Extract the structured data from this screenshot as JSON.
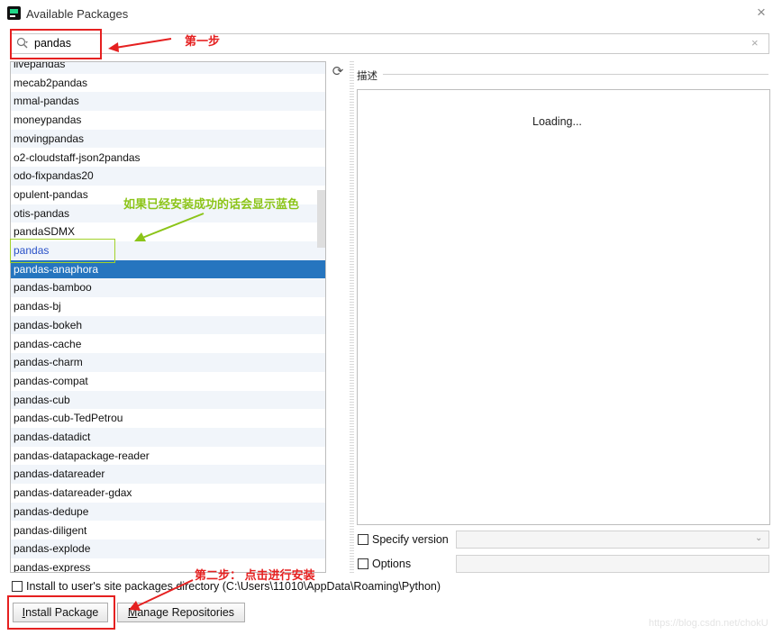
{
  "window": {
    "title": "Available Packages",
    "close_icon": "close-icon"
  },
  "search": {
    "value": "pandas",
    "clear_glyph": "×"
  },
  "packages": [
    "livepandas",
    "mecab2pandas",
    "mmal-pandas",
    "moneypandas",
    "movingpandas",
    "o2-cloudstaff-json2pandas",
    "odo-fixpandas20",
    "opulent-pandas",
    "otis-pandas",
    "pandaSDMX",
    "pandas",
    "pandas-anaphora",
    "pandas-bamboo",
    "pandas-bj",
    "pandas-bokeh",
    "pandas-cache",
    "pandas-charm",
    "pandas-compat",
    "pandas-cub",
    "pandas-cub-TedPetrou",
    "pandas-datadict",
    "pandas-datapackage-reader",
    "pandas-datareader",
    "pandas-datareader-gdax",
    "pandas-dedupe",
    "pandas-diligent",
    "pandas-explode",
    "pandas-express"
  ],
  "selected_package": "pandas-anaphora",
  "installed_package": "pandas",
  "description": {
    "label": "描述",
    "loading_text": "Loading..."
  },
  "options": {
    "specify_version_label": "Specify version",
    "options_label": "Options",
    "install_user_label": "Install to user's site packages directory (C:\\Users\\11010\\AppData\\Roaming\\Python)"
  },
  "buttons": {
    "install": "Install Package",
    "manage": "Manage Repositories"
  },
  "annotations": {
    "step1": "第一步",
    "installed_note": "如果已经安装成功的话会显示蓝色",
    "step2": "第二步： 点击进行安装"
  },
  "watermark": "https://blog.csdn.net/chokU",
  "colors": {
    "selection": "#2675bf",
    "installed_text": "#2850c8",
    "annotation_red": "#e52020",
    "annotation_green": "#8bc418"
  }
}
